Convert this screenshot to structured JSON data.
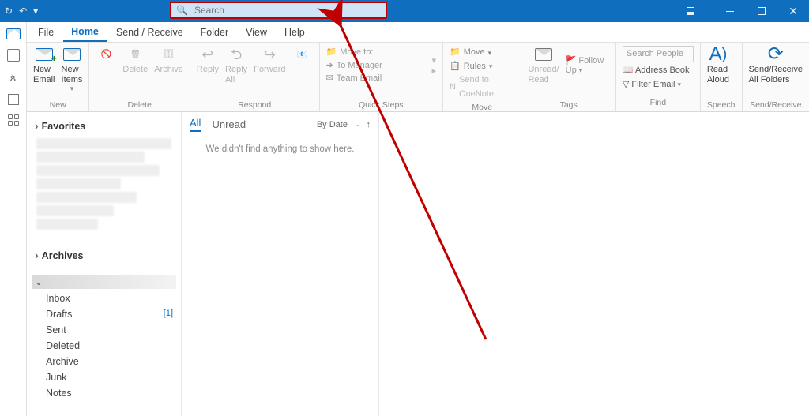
{
  "titlebar": {
    "search_placeholder": "Search"
  },
  "menu": {
    "file": "File",
    "home": "Home",
    "sendreceive": "Send / Receive",
    "folder": "Folder",
    "view": "View",
    "help": "Help"
  },
  "ribbon": {
    "new": {
      "label": "New",
      "new_email": "New\nEmail",
      "new_items": "New\nItems"
    },
    "delete": {
      "label": "Delete",
      "delete": "Delete",
      "archive": "Archive"
    },
    "respond": {
      "label": "Respond",
      "reply": "Reply",
      "reply_all": "Reply\nAll",
      "forward": "Forward"
    },
    "quicksteps": {
      "label": "Quick Steps",
      "items": [
        "Move to:",
        "To Manager",
        "Team Email"
      ]
    },
    "move": {
      "label": "Move",
      "move": "Move",
      "rules": "Rules",
      "onenote": "Send to OneNote"
    },
    "tags": {
      "label": "Tags",
      "unread": "Unread/\nRead",
      "followup": "Follow Up"
    },
    "find": {
      "label": "Find",
      "search_people": "Search People",
      "address_book": "Address Book",
      "filter_email": "Filter Email"
    },
    "speech": {
      "label": "Speech",
      "read_aloud": "Read\nAloud"
    },
    "sendrecv": {
      "label": "Send/Receive",
      "all_folders": "Send/Receive\nAll Folders"
    }
  },
  "nav": {
    "favorites": "Favorites",
    "archives": "Archives",
    "folders": {
      "inbox": "Inbox",
      "drafts": "Drafts",
      "drafts_count": "[1]",
      "sent": "Sent",
      "deleted": "Deleted",
      "archive": "Archive",
      "junk": "Junk",
      "notes": "Notes"
    }
  },
  "list": {
    "all": "All",
    "unread": "Unread",
    "sort": "By Date",
    "empty": "We didn't find anything to show here."
  }
}
